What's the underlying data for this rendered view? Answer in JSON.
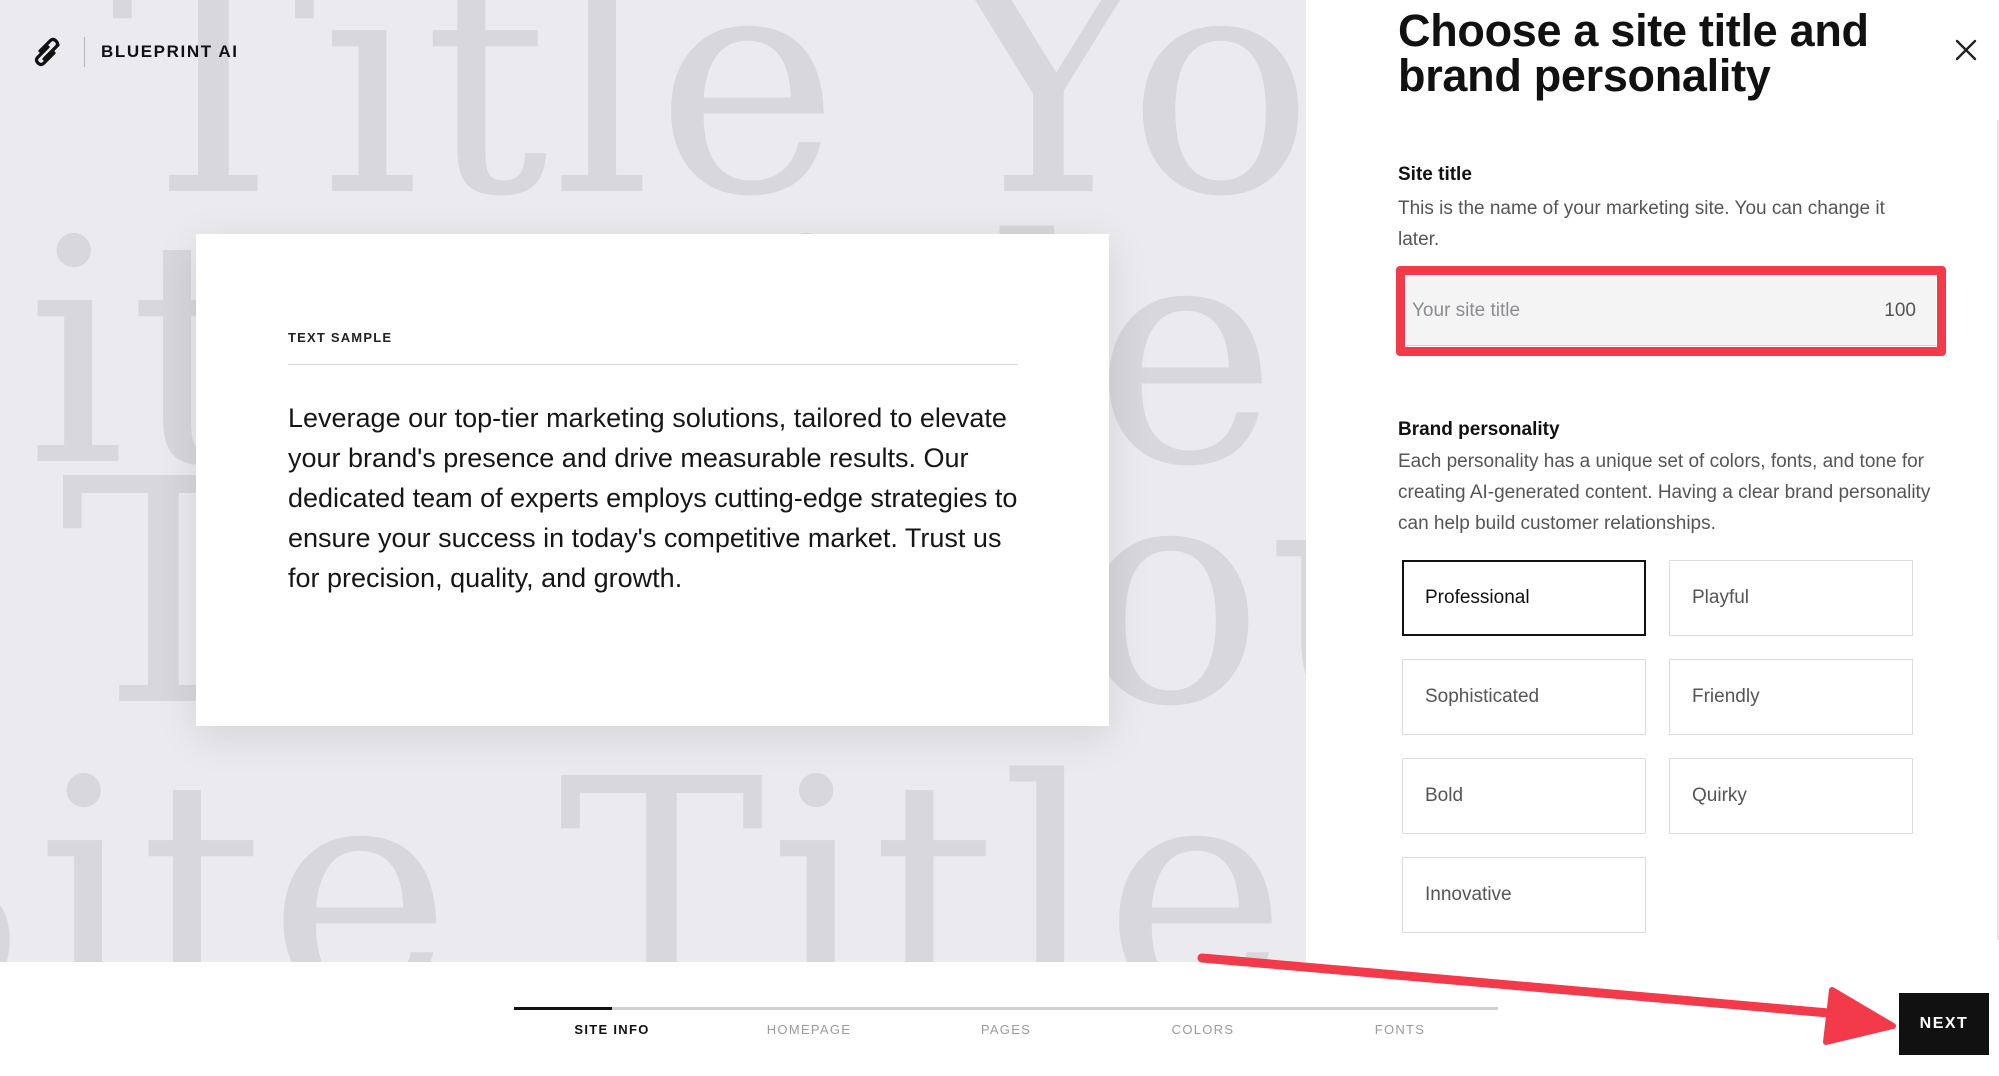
{
  "app": {
    "brand_name": "BLUEPRINT AI",
    "logo_icon": "blueprint-logo-icon"
  },
  "preview": {
    "background_words": [
      "Title Your",
      "Site Title Your Site T",
      "Title Your",
      "Site Title Your Site T"
    ],
    "sample_label": "TEXT SAMPLE",
    "sample_text": "Leverage our top-tier marketing solutions, tailored to elevate your brand's presence and drive measurable results. Our dedicated team of experts employs cutting-edge strategies to ensure your success in today's competitive market. Trust us for precision, quality, and growth."
  },
  "panel": {
    "title": "Choose a site title and brand personality",
    "close_icon": "close-icon",
    "site_title": {
      "label": "Site title",
      "description": "This is the name of your marketing site. You can change it later.",
      "placeholder": "Your site title",
      "value": "",
      "remaining": "100"
    },
    "brand_personality": {
      "label": "Brand personality",
      "description": "Each personality has a unique set of colors, fonts, and tone for creating AI-generated content. Having a clear brand personality can help build customer relationships.",
      "options": [
        {
          "label": "Professional",
          "selected": true
        },
        {
          "label": "Playful",
          "selected": false
        },
        {
          "label": "Sophisticated",
          "selected": false
        },
        {
          "label": "Friendly",
          "selected": false
        },
        {
          "label": "Bold",
          "selected": false
        },
        {
          "label": "Quirky",
          "selected": false
        },
        {
          "label": "Innovative",
          "selected": false
        }
      ]
    }
  },
  "steps": {
    "items": [
      {
        "label": "SITE INFO",
        "active": true
      },
      {
        "label": "HOMEPAGE",
        "active": false
      },
      {
        "label": "PAGES",
        "active": false
      },
      {
        "label": "COLORS",
        "active": false
      },
      {
        "label": "FONTS",
        "active": false
      }
    ],
    "progress": 0.1
  },
  "footer": {
    "next_label": "NEXT"
  },
  "annotations": {
    "highlight_color": "#f23a4a"
  }
}
